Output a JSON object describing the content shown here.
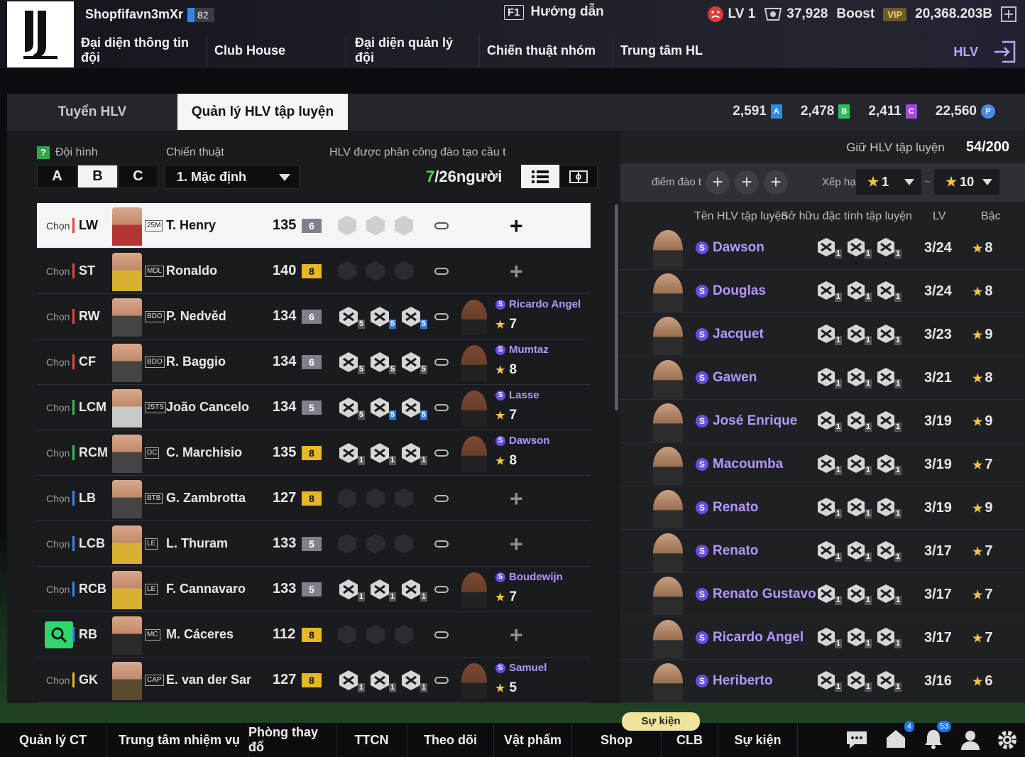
{
  "header": {
    "username": "Shopfifavn3mXr",
    "team_ovr": "82",
    "guide_key": "F1",
    "guide_label": "Hướng dẫn",
    "level": "LV 1",
    "coins": "37,928",
    "boost": "Boost",
    "vip": "VIP",
    "bp": "20,368.203B"
  },
  "nav": {
    "items": [
      "Đại diện thông tin đội",
      "Club House",
      "Đại diện quản lý đội",
      "Chiến thuật nhóm",
      "Trung tâm HL"
    ],
    "hlv": "HLV"
  },
  "tabs": [
    "Tuyển HLV",
    "Quản lý HLV tập luyện"
  ],
  "currency": [
    {
      "value": "2,591",
      "letter": "A",
      "color": "#2f8be6"
    },
    {
      "value": "2,478",
      "letter": "B",
      "color": "#2fbf5a"
    },
    {
      "value": "2,411",
      "letter": "C",
      "color": "#a64ad8"
    },
    {
      "value": "22,560",
      "letter": "P",
      "color": "#4a8be8"
    }
  ],
  "left": {
    "formation_label": "Đội hình",
    "help": "?",
    "tactic_label": "Chiến thuật",
    "assigned_label": "HLV được phân công đào tạo cầu t",
    "formations": [
      "A",
      "B",
      "C"
    ],
    "tactic_value": "1. Mặc định",
    "count_current": "7",
    "count_rest": "/26người",
    "chon": "Chọn"
  },
  "players": [
    {
      "pos": "LW",
      "pos_color": "#e74343",
      "season": "25M",
      "name": "T. Henry",
      "ovr": "135",
      "lvl": "6",
      "lvl_color": "#7e8188",
      "skills": null,
      "coach": null,
      "selected": true,
      "face": "#b33636"
    },
    {
      "pos": "ST",
      "pos_color": "#e74343",
      "season": "MDL",
      "name": "Ronaldo",
      "ovr": "140",
      "lvl": "8",
      "lvl_color": "#e6b824",
      "skills": null,
      "coach": null,
      "face": "#d8b032"
    },
    {
      "pos": "RW",
      "pos_color": "#e74343",
      "season": "BDO",
      "name": "P. Nedvěd",
      "ovr": "134",
      "lvl": "6",
      "lvl_color": "#7e8188",
      "skills": [
        "5",
        "5",
        "5"
      ],
      "skill_blue": [
        false,
        true,
        true
      ],
      "coach": {
        "name": "Ricardo Angel",
        "stars": "7"
      },
      "face": "#444"
    },
    {
      "pos": "CF",
      "pos_color": "#e74343",
      "season": "BDO",
      "name": "R. Baggio",
      "ovr": "134",
      "lvl": "6",
      "lvl_color": "#7e8188",
      "skills": [
        "5",
        "5",
        "5"
      ],
      "skill_blue": [
        false,
        false,
        false
      ],
      "coach": {
        "name": "Mumtaz",
        "stars": "8"
      },
      "face": "#444"
    },
    {
      "pos": "LCM",
      "pos_color": "#2fbf5a",
      "season": "25TS",
      "name": "João Cancelo",
      "ovr": "134",
      "lvl": "5",
      "lvl_color": "#7e8188",
      "skills": [
        "5",
        "5",
        "5"
      ],
      "skill_blue": [
        false,
        true,
        true
      ],
      "coach": {
        "name": "Lasse",
        "stars": "7"
      },
      "face": "#c9c9c9"
    },
    {
      "pos": "RCM",
      "pos_color": "#2fbf5a",
      "season": "DC",
      "name": "C. Marchisio",
      "ovr": "135",
      "lvl": "8",
      "lvl_color": "#e6b824",
      "skills": [
        "1",
        "1",
        "1"
      ],
      "skill_blue": [
        false,
        false,
        false
      ],
      "coach": {
        "name": "Dawson",
        "stars": "8"
      },
      "face": "#444"
    },
    {
      "pos": "LB",
      "pos_color": "#3b83e8",
      "season": "BTB",
      "name": "G. Zambrotta",
      "ovr": "127",
      "lvl": "8",
      "lvl_color": "#e6b824",
      "skills": null,
      "coach": null,
      "face": "#444"
    },
    {
      "pos": "LCB",
      "pos_color": "#3b83e8",
      "season": "LE",
      "name": "L. Thuram",
      "ovr": "133",
      "lvl": "5",
      "lvl_color": "#7e8188",
      "skills": null,
      "coach": null,
      "face": "#d8b032"
    },
    {
      "pos": "RCB",
      "pos_color": "#3b83e8",
      "season": "LE",
      "name": "F. Cannavaro",
      "ovr": "133",
      "lvl": "5",
      "lvl_color": "#7e8188",
      "skills": [
        "1",
        "1",
        "1"
      ],
      "skill_blue": [
        false,
        false,
        false
      ],
      "coach": {
        "name": "Boudewijn",
        "stars": "7"
      },
      "face": "#d8b032"
    },
    {
      "pos": "RB",
      "pos_color": "#3b83e8",
      "season": "MC",
      "name": "M. Cáceres",
      "ovr": "112",
      "lvl": "8",
      "lvl_color": "#e6b824",
      "skills": null,
      "coach": null,
      "search": true,
      "face": "#2a2a2a"
    },
    {
      "pos": "GK",
      "pos_color": "#e6b824",
      "season": "CAP",
      "name": "E. van der Sar",
      "ovr": "127",
      "lvl": "8",
      "lvl_color": "#e6b824",
      "skills": [
        "1",
        "1",
        "1"
      ],
      "skill_blue": [
        false,
        false,
        false
      ],
      "coach": {
        "name": "Samuel",
        "stars": "5"
      },
      "face": "#5a4a30"
    }
  ],
  "right": {
    "keep_label": "Giữ HLV tập luyện",
    "keep_value": "54/200",
    "points_label": "điểm đào t",
    "rank_label": "Xếp hạ",
    "rank_from": "1",
    "rank_to": "10",
    "rank_sep": "~",
    "col_name": "Tên HLV tập luyện",
    "col_traits": "Sở hữu đặc tính tập luyện",
    "col_lv": "LV",
    "col_grade": "Bậc"
  },
  "coaches": [
    {
      "name": "Dawson",
      "lv": "3/24",
      "stars": "8"
    },
    {
      "name": "Douglas",
      "lv": "3/24",
      "stars": "8"
    },
    {
      "name": "Jacquet",
      "lv": "3/23",
      "stars": "9"
    },
    {
      "name": "Gawen",
      "lv": "3/21",
      "stars": "8"
    },
    {
      "name": "José Enrique",
      "lv": "3/19",
      "stars": "9"
    },
    {
      "name": "Macoumba",
      "lv": "3/19",
      "stars": "7"
    },
    {
      "name": "Renato",
      "lv": "3/19",
      "stars": "9"
    },
    {
      "name": "Renato",
      "lv": "3/17",
      "stars": "7"
    },
    {
      "name": "Renato Gustavo",
      "lv": "3/17",
      "stars": "7"
    },
    {
      "name": "Ricardo Angel",
      "lv": "3/17",
      "stars": "7"
    },
    {
      "name": "Heriberto",
      "lv": "3/16",
      "stars": "6"
    }
  ],
  "coach_skill_level": "1",
  "bottom": {
    "items": [
      "Quản lý CT",
      "Trung tâm nhiệm vụ",
      "Phòng thay đổ",
      "TTCN",
      "Theo dõi",
      "Vật phẩm",
      "Shop",
      "CLB",
      "Sự kiện"
    ],
    "event_badge": "Sự kiện",
    "notif_home": "4",
    "notif_bell": "53"
  }
}
